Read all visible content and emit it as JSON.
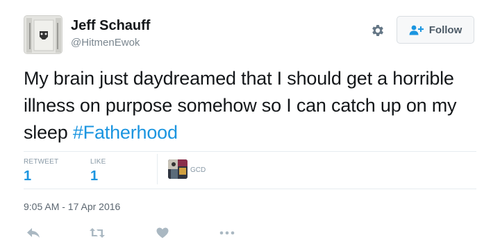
{
  "tweet": {
    "author": {
      "name": "Jeff Schauff",
      "handle": "@HitmenEwok"
    },
    "follow_label": "Follow",
    "text": "My brain  just daydreamed that I should get a horrible illness on purpose somehow so I can catch up on my sleep ",
    "hashtag": "#Fatherhood",
    "stats": {
      "retweets_label": "RETWEET",
      "retweets": "1",
      "likes_label": "LIKE",
      "likes": "1"
    },
    "liker_name": "GCD",
    "timestamp": "9:05 AM - 17 Apr 2016"
  },
  "icons": [
    "gear-icon",
    "follow-person-plus-icon",
    "reply-icon",
    "retweet-icon",
    "like-heart-icon",
    "more-dots-icon"
  ],
  "colors": {
    "link": "#1b95e0",
    "muted": "#8899a6",
    "text": "#14171a",
    "icon": "#aab8c2"
  }
}
